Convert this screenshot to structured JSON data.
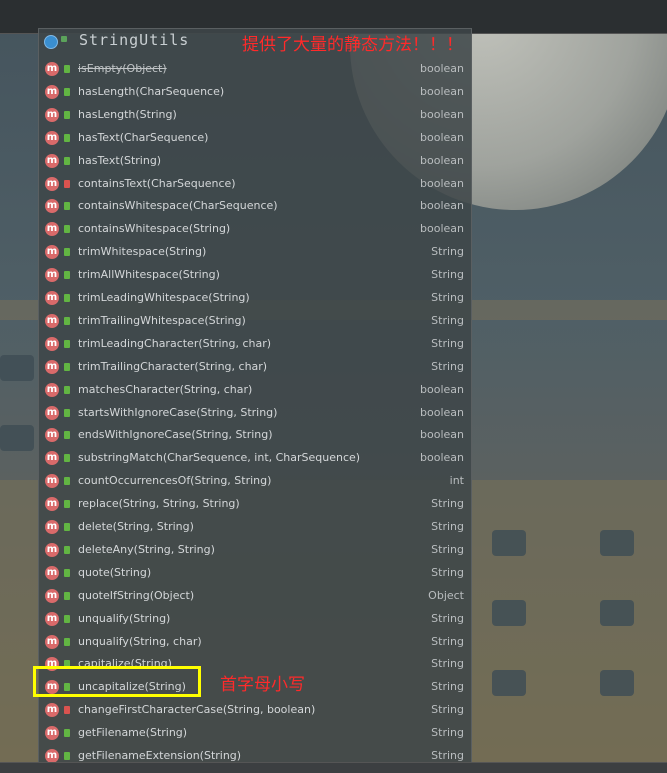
{
  "popup": {
    "class_name": "StringUtils",
    "methods": [
      {
        "name": "isEmpty(Object)",
        "type": "boolean",
        "deprecated": true,
        "access": "public"
      },
      {
        "name": "hasLength(CharSequence)",
        "type": "boolean",
        "access": "public"
      },
      {
        "name": "hasLength(String)",
        "type": "boolean",
        "access": "public"
      },
      {
        "name": "hasText(CharSequence)",
        "type": "boolean",
        "access": "public"
      },
      {
        "name": "hasText(String)",
        "type": "boolean",
        "access": "public"
      },
      {
        "name": "containsText(CharSequence)",
        "type": "boolean",
        "access": "private"
      },
      {
        "name": "containsWhitespace(CharSequence)",
        "type": "boolean",
        "access": "public"
      },
      {
        "name": "containsWhitespace(String)",
        "type": "boolean",
        "access": "public"
      },
      {
        "name": "trimWhitespace(String)",
        "type": "String",
        "access": "public"
      },
      {
        "name": "trimAllWhitespace(String)",
        "type": "String",
        "access": "public"
      },
      {
        "name": "trimLeadingWhitespace(String)",
        "type": "String",
        "access": "public"
      },
      {
        "name": "trimTrailingWhitespace(String)",
        "type": "String",
        "access": "public"
      },
      {
        "name": "trimLeadingCharacter(String, char)",
        "type": "String",
        "access": "public"
      },
      {
        "name": "trimTrailingCharacter(String, char)",
        "type": "String",
        "access": "public"
      },
      {
        "name": "matchesCharacter(String, char)",
        "type": "boolean",
        "access": "public"
      },
      {
        "name": "startsWithIgnoreCase(String, String)",
        "type": "boolean",
        "access": "public"
      },
      {
        "name": "endsWithIgnoreCase(String, String)",
        "type": "boolean",
        "access": "public"
      },
      {
        "name": "substringMatch(CharSequence, int, CharSequence)",
        "type": "boolean",
        "access": "public"
      },
      {
        "name": "countOccurrencesOf(String, String)",
        "type": "int",
        "access": "public"
      },
      {
        "name": "replace(String, String, String)",
        "type": "String",
        "access": "public"
      },
      {
        "name": "delete(String, String)",
        "type": "String",
        "access": "public"
      },
      {
        "name": "deleteAny(String, String)",
        "type": "String",
        "access": "public"
      },
      {
        "name": "quote(String)",
        "type": "String",
        "access": "public"
      },
      {
        "name": "quoteIfString(Object)",
        "type": "Object",
        "access": "public"
      },
      {
        "name": "unqualify(String)",
        "type": "String",
        "access": "public"
      },
      {
        "name": "unqualify(String, char)",
        "type": "String",
        "access": "public"
      },
      {
        "name": "capitalize(String)",
        "type": "String",
        "access": "public"
      },
      {
        "name": "uncapitalize(String)",
        "type": "String",
        "access": "public"
      },
      {
        "name": "changeFirstCharacterCase(String, boolean)",
        "type": "String",
        "access": "private"
      },
      {
        "name": "getFilename(String)",
        "type": "String",
        "access": "public"
      },
      {
        "name": "getFilenameExtension(String)",
        "type": "String",
        "access": "public"
      }
    ],
    "method_icon_letter": "m"
  },
  "annotations": {
    "header_note": "提供了大量的静态方法！！！",
    "highlight_note": "首字母小写"
  },
  "colors": {
    "method_icon": "#d96a6a",
    "public_lock": "#62b543",
    "private_lock": "#d9534f",
    "annotation_red": "#ff2a2a",
    "highlight_yellow": "#ffff00"
  }
}
